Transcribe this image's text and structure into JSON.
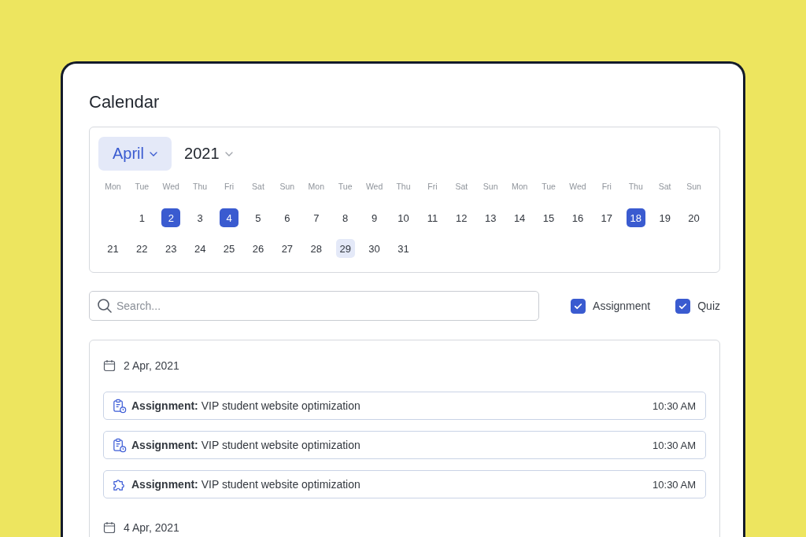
{
  "title": "Calendar",
  "month": {
    "label": "April",
    "selected": true
  },
  "year": {
    "label": "2021",
    "selected": false
  },
  "weekdays": [
    "Mon",
    "Tue",
    "Wed",
    "Thu",
    "Fri",
    "Sat",
    "Sun",
    "Mon",
    "Tue",
    "Wed",
    "Thu",
    "Fri",
    "Sat",
    "Sun",
    "Mon",
    "Tue",
    "Wed",
    "Fri",
    "Thu",
    "Sat",
    "Sun"
  ],
  "days": [
    {
      "label": "1",
      "selected": false,
      "highlighted": false
    },
    {
      "label": "2",
      "selected": true,
      "highlighted": false
    },
    {
      "label": "3",
      "selected": false,
      "highlighted": false
    },
    {
      "label": "4",
      "selected": true,
      "highlighted": false
    },
    {
      "label": "5",
      "selected": false,
      "highlighted": false
    },
    {
      "label": "6",
      "selected": false,
      "highlighted": false
    },
    {
      "label": "7",
      "selected": false,
      "highlighted": false
    },
    {
      "label": "8",
      "selected": false,
      "highlighted": false
    },
    {
      "label": "9",
      "selected": false,
      "highlighted": false
    },
    {
      "label": "10",
      "selected": false,
      "highlighted": false
    },
    {
      "label": "11",
      "selected": false,
      "highlighted": false
    },
    {
      "label": "12",
      "selected": false,
      "highlighted": false
    },
    {
      "label": "13",
      "selected": false,
      "highlighted": false
    },
    {
      "label": "14",
      "selected": false,
      "highlighted": false
    },
    {
      "label": "15",
      "selected": false,
      "highlighted": false
    },
    {
      "label": "16",
      "selected": false,
      "highlighted": false
    },
    {
      "label": "17",
      "selected": false,
      "highlighted": false
    },
    {
      "label": "18",
      "selected": true,
      "highlighted": false
    },
    {
      "label": "19",
      "selected": false,
      "highlighted": false
    },
    {
      "label": "20",
      "selected": false,
      "highlighted": false
    },
    {
      "label": "21",
      "selected": false,
      "highlighted": false
    },
    {
      "label": "22",
      "selected": false,
      "highlighted": false
    },
    {
      "label": "23",
      "selected": false,
      "highlighted": false
    },
    {
      "label": "24",
      "selected": false,
      "highlighted": false
    },
    {
      "label": "25",
      "selected": false,
      "highlighted": false
    },
    {
      "label": "26",
      "selected": false,
      "highlighted": false
    },
    {
      "label": "27",
      "selected": false,
      "highlighted": false
    },
    {
      "label": "28",
      "selected": false,
      "highlighted": false
    },
    {
      "label": "29",
      "selected": false,
      "highlighted": true
    },
    {
      "label": "30",
      "selected": false,
      "highlighted": false
    },
    {
      "label": "31",
      "selected": false,
      "highlighted": false
    }
  ],
  "search": {
    "placeholder": "Search..."
  },
  "filters": [
    {
      "label": "Assignment",
      "checked": true
    },
    {
      "label": "Quiz",
      "checked": true
    }
  ],
  "groups": [
    {
      "date": "2 Apr, 2021",
      "events": [
        {
          "kind": "clipboard",
          "text": "**Assignment:** VIP student website optimization",
          "time": "10:30 AM"
        },
        {
          "kind": "clipboard",
          "text": "**Assignment:** VIP student website optimization",
          "time": "10:30 AM"
        },
        {
          "kind": "puzzle",
          "text": "**Assignment:** VIP student website optimization",
          "time": "10:30 AM"
        }
      ]
    },
    {
      "date": "4 Apr, 2021"
    }
  ]
}
